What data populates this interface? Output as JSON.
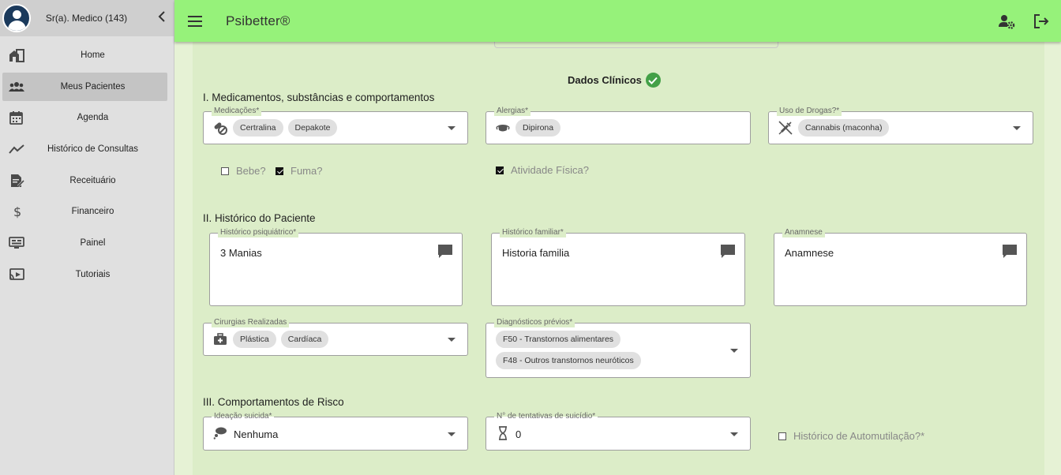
{
  "app": {
    "title": "Psibetter®"
  },
  "sidebar": {
    "user_label": "Sr(a). Medico (143)",
    "items": [
      {
        "label": "Home",
        "icon": "home-icon"
      },
      {
        "label": "Meus Pacientes",
        "icon": "people-icon",
        "active": true
      },
      {
        "label": "Agenda",
        "icon": "calendar-icon"
      },
      {
        "label": "Histórico de Consultas",
        "icon": "trend-icon"
      },
      {
        "label": "Receituário",
        "icon": "prescription-icon"
      },
      {
        "label": "Financeiro",
        "icon": "dollar-icon"
      },
      {
        "label": "Painel",
        "icon": "monitor-icon"
      },
      {
        "label": "Tutoriais",
        "icon": "cast-icon"
      }
    ]
  },
  "form": {
    "title": "Dados Clínicos",
    "section1": {
      "title": "I. Medicamentos, substâncias e comportamentos",
      "medicacoes": {
        "label": "Medicações*",
        "chips": [
          "Certralina",
          "Depakote"
        ]
      },
      "alergias": {
        "label": "Alergias*",
        "chips": [
          "Dipirona"
        ]
      },
      "drogas": {
        "label": "Uso de Drogas?*",
        "chips": [
          "Cannabis (maconha)"
        ]
      },
      "bebe": {
        "label": "Bebe?",
        "checked": false
      },
      "fuma": {
        "label": "Fuma?",
        "checked": true
      },
      "atividade": {
        "label": "Atividade Física?",
        "checked": true
      }
    },
    "section2": {
      "title": "II. Histórico do Paciente",
      "psiquiatrico": {
        "label": "Histórico psiquiátrico*",
        "value": "3 Manias"
      },
      "familiar": {
        "label": "Histórico familiar*",
        "value": "Historia familia"
      },
      "anamnese": {
        "label": "Anamnese",
        "value": "Anamnese"
      },
      "cirurgias": {
        "label": "Cirurgias Realizadas",
        "chips": [
          "Plástica",
          "Cardíaca"
        ]
      },
      "diagnosticos": {
        "label": "Diagnósticos prévios*",
        "chips": [
          "F50 - Transtornos alimentares",
          "F48 - Outros transtornos neuróticos"
        ]
      }
    },
    "section3": {
      "title": "III. Comportamentos de Risco",
      "ideacao": {
        "label": "Ideação suicida*",
        "value": "Nenhuma"
      },
      "tentativas": {
        "label": "N° de tentativas de suicídio*",
        "value": "0"
      },
      "automutilacao": {
        "label": "Histórico de Automutilação?*",
        "checked": false
      }
    }
  }
}
